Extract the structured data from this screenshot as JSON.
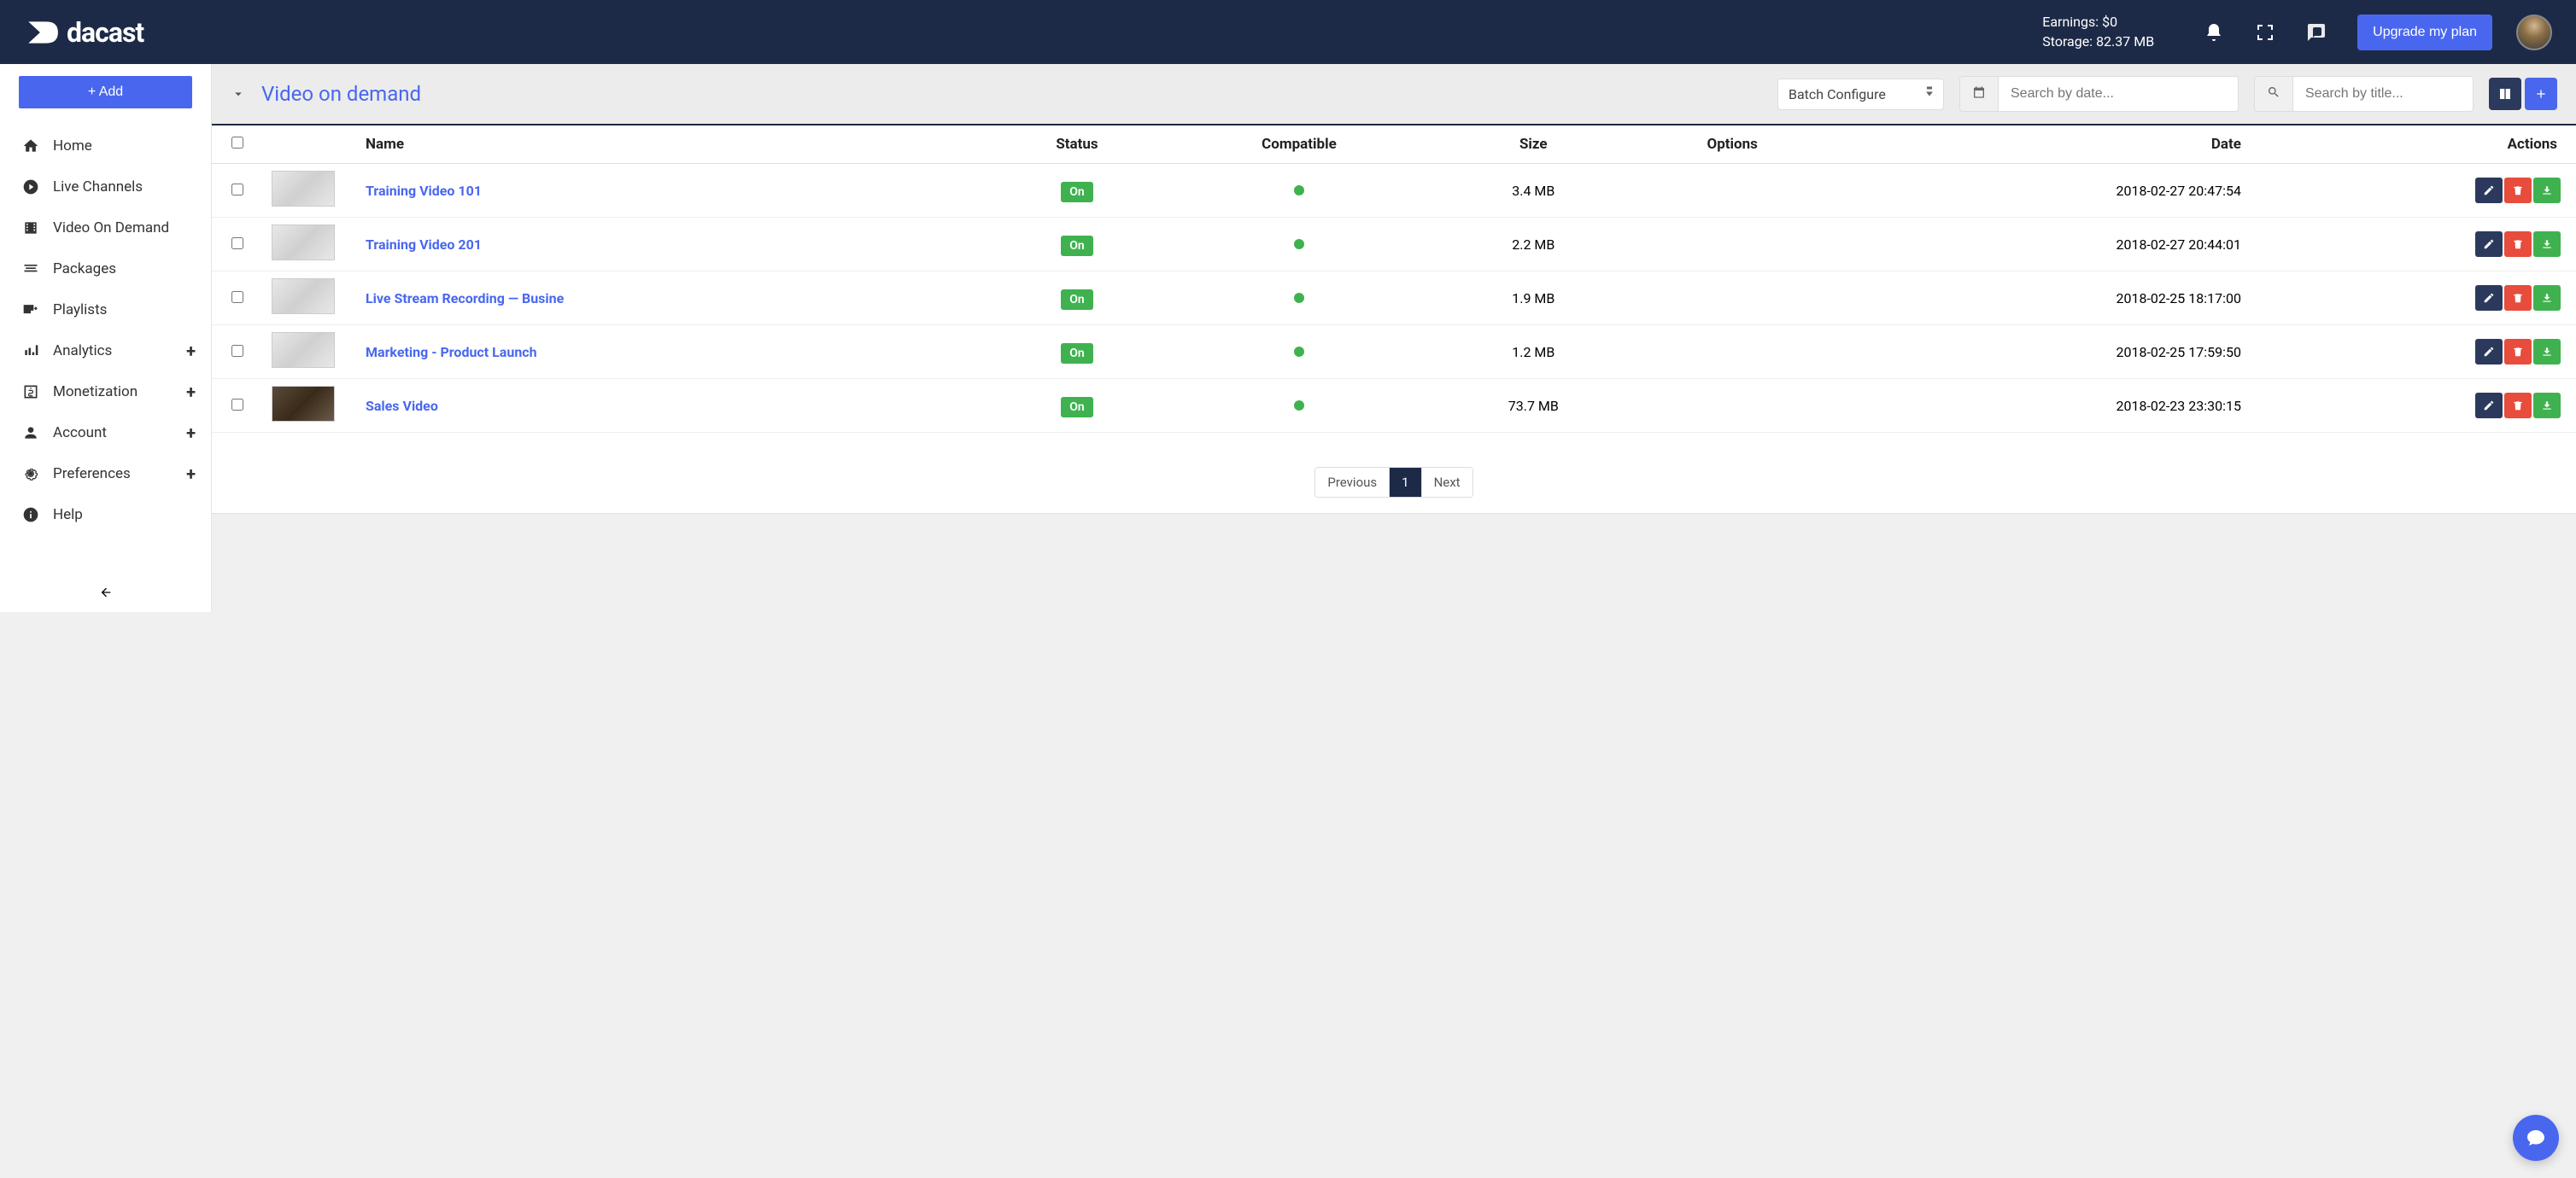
{
  "brand": "dacast",
  "header": {
    "earnings_label": "Earnings: $0",
    "storage_label": "Storage: 82.37 MB",
    "upgrade_label": "Upgrade my plan"
  },
  "sidebar": {
    "add_label": "+ Add",
    "items": [
      {
        "label": "Home",
        "icon": "home",
        "expand": false
      },
      {
        "label": "Live Channels",
        "icon": "play-circle",
        "expand": false
      },
      {
        "label": "Video On Demand",
        "icon": "film",
        "expand": false
      },
      {
        "label": "Packages",
        "icon": "package",
        "expand": false
      },
      {
        "label": "Playlists",
        "icon": "playlist",
        "expand": false
      },
      {
        "label": "Analytics",
        "icon": "chart",
        "expand": true
      },
      {
        "label": "Monetization",
        "icon": "dollar",
        "expand": true
      },
      {
        "label": "Account",
        "icon": "person",
        "expand": true
      },
      {
        "label": "Preferences",
        "icon": "gear",
        "expand": true
      },
      {
        "label": "Help",
        "icon": "info",
        "expand": false
      }
    ]
  },
  "toolbar": {
    "title": "Video on demand",
    "batch_label": "Batch Configure",
    "search_date_placeholder": "Search by date...",
    "search_title_placeholder": "Search by title..."
  },
  "table": {
    "columns": {
      "name": "Name",
      "status": "Status",
      "compatible": "Compatible",
      "size": "Size",
      "options": "Options",
      "date": "Date",
      "actions": "Actions"
    },
    "rows": [
      {
        "name": "Training Video 101",
        "status": "On",
        "size": "3.4 MB",
        "date": "2018-02-27 20:47:54",
        "thumb": "light"
      },
      {
        "name": "Training Video 201",
        "status": "On",
        "size": "2.2 MB",
        "date": "2018-02-27 20:44:01",
        "thumb": "light"
      },
      {
        "name": "Live Stream Recording — Busine",
        "status": "On",
        "size": "1.9 MB",
        "date": "2018-02-25 18:17:00",
        "thumb": "light"
      },
      {
        "name": "Marketing - Product Launch",
        "status": "On",
        "size": "1.2 MB",
        "date": "2018-02-25 17:59:50",
        "thumb": "light"
      },
      {
        "name": "Sales Video",
        "status": "On",
        "size": "73.7 MB",
        "date": "2018-02-23 23:30:15",
        "thumb": "dark"
      }
    ]
  },
  "pagination": {
    "prev": "Previous",
    "current": "1",
    "next": "Next"
  }
}
